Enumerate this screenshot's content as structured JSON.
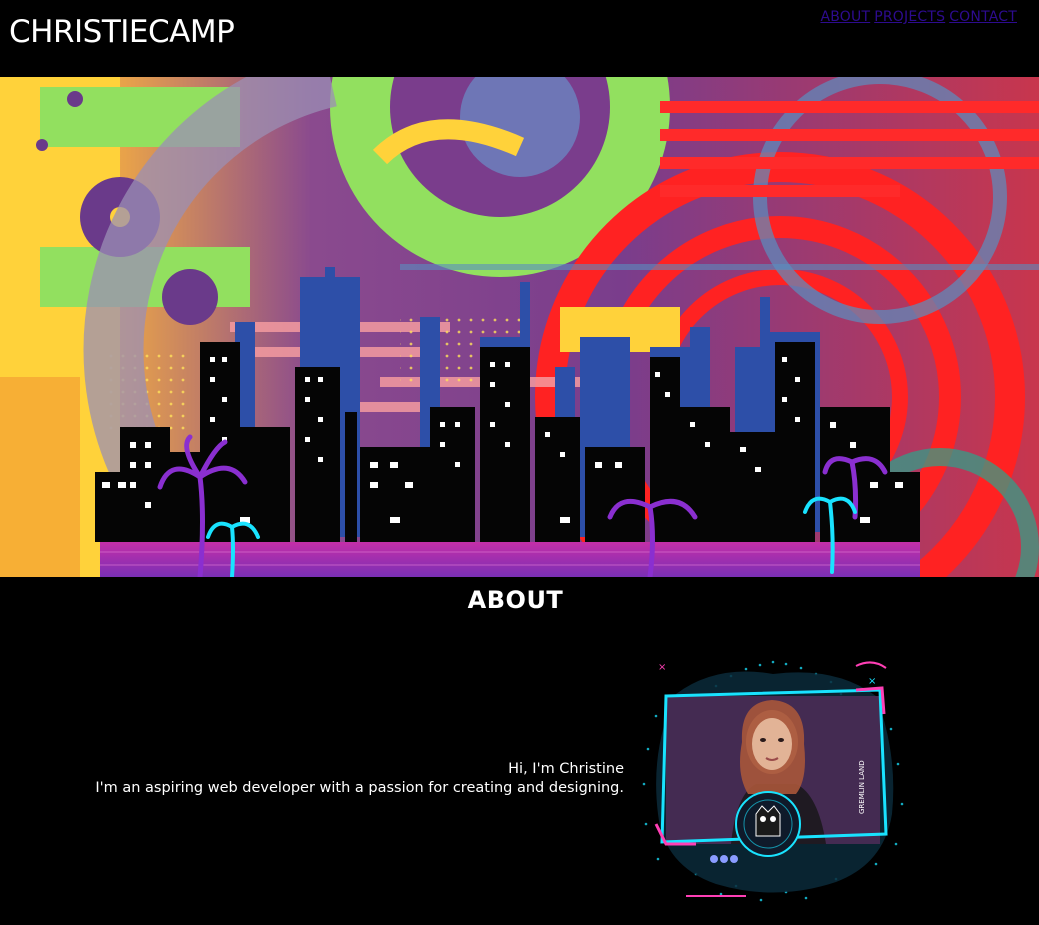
{
  "header": {
    "logo": "CHRISTIECAMP",
    "nav": [
      {
        "label": "ABOUT"
      },
      {
        "label": "PROJECTS"
      },
      {
        "label": "CONTACT"
      }
    ]
  },
  "about": {
    "title": "ABOUT",
    "greeting": "Hi, I'm Christine",
    "bio": "I'm an aspiring web developer with a passion for creating and designing.",
    "badge_text": "GREMLIN LAND"
  },
  "colors": {
    "nav_link": "#2d0b8f",
    "background": "#000000",
    "neon_cyan": "#19e3ff",
    "neon_pink": "#ff3fb5"
  }
}
